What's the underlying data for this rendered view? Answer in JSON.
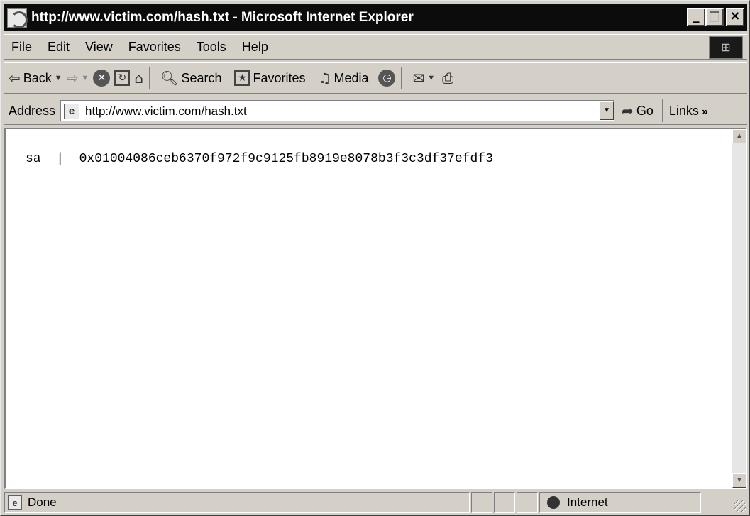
{
  "window": {
    "title": "http://www.victim.com/hash.txt - Microsoft Internet Explorer",
    "buttons": {
      "minimize": "_",
      "maximize": "□",
      "close": "×"
    }
  },
  "menu": {
    "items": [
      "File",
      "Edit",
      "View",
      "Favorites",
      "Tools",
      "Help"
    ]
  },
  "toolbar": {
    "back_label": "Back",
    "search_label": "Search",
    "favorites_label": "Favorites",
    "media_label": "Media"
  },
  "address": {
    "label": "Address",
    "url": "http://www.victim.com/hash.txt",
    "go_label": "Go",
    "links_label": "Links"
  },
  "page": {
    "text": "sa  |  0x01004086ceb6370f972f9c9125fb8919e8078b3f3c3df37efdf3"
  },
  "status": {
    "text": "Done",
    "zone": "Internet"
  }
}
